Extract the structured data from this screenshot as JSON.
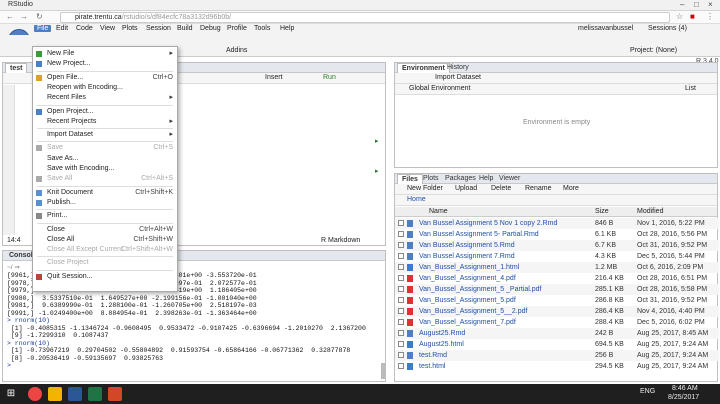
{
  "window": {
    "title": "RStudio"
  },
  "browser": {
    "url_scheme": "pirate.trentu.ca",
    "url_path": "/rstudio/s/df84ecfc78a3132d96b0b/"
  },
  "app_menu": [
    "File",
    "Edit",
    "Code",
    "View",
    "Plots",
    "Session",
    "Build",
    "Debug",
    "Profile",
    "Tools",
    "Help"
  ],
  "user": "melissavanbussel",
  "sessions": "Sessions (4)",
  "project": "Project: (None)",
  "r_version": "R 3.4.0",
  "toolbar": {
    "addins": "Addins"
  },
  "file_menu": [
    {
      "label": "New File",
      "arrow": "▸"
    },
    {
      "label": "New Project...",
      "shortcut": ""
    },
    {
      "sep": true
    },
    {
      "label": "Open File...",
      "shortcut": "Ctrl+O"
    },
    {
      "label": "Reopen with Encoding...",
      "shortcut": ""
    },
    {
      "label": "Recent Files",
      "arrow": "▸"
    },
    {
      "sep": true
    },
    {
      "label": "Open Project...",
      "shortcut": ""
    },
    {
      "label": "Recent Projects",
      "arrow": "▸"
    },
    {
      "sep": true
    },
    {
      "label": "Import Dataset",
      "arrow": "▸"
    },
    {
      "sep": true
    },
    {
      "label": "Save",
      "shortcut": "Ctrl+S",
      "disabled": true
    },
    {
      "label": "Save As...",
      "shortcut": ""
    },
    {
      "label": "Save with Encoding...",
      "shortcut": ""
    },
    {
      "label": "Save All",
      "shortcut": "Ctrl+Alt+S",
      "disabled": true
    },
    {
      "sep": true
    },
    {
      "label": "Knit Document",
      "shortcut": "Ctrl+Shift+K"
    },
    {
      "label": "Publish...",
      "shortcut": ""
    },
    {
      "sep": true
    },
    {
      "label": "Print...",
      "shortcut": ""
    },
    {
      "sep": true
    },
    {
      "label": "Close",
      "shortcut": "Ctrl+Alt+W"
    },
    {
      "label": "Close All",
      "shortcut": "Ctrl+Shift+W"
    },
    {
      "label": "Close All Except Current",
      "shortcut": "Ctrl+Shift+Alt+W",
      "disabled": true
    },
    {
      "sep": true
    },
    {
      "label": "Close Project",
      "shortcut": "",
      "disabled": true
    },
    {
      "sep": true
    },
    {
      "label": "Quit Session...",
      "shortcut": ""
    }
  ],
  "editor": {
    "tab": "test",
    "insert": "Insert",
    "run": "Run",
    "pos": "14:4",
    "mode": "R Markdown"
  },
  "env": {
    "tabs": [
      "Environment",
      "History"
    ],
    "import": "Import Dataset",
    "scope": "Global Environment",
    "list": "List",
    "empty": "Environment is empty"
  },
  "files": {
    "tabs": [
      "Files",
      "Plots",
      "Packages",
      "Help",
      "Viewer"
    ],
    "toolbar": [
      "New Folder",
      "Upload",
      "Delete",
      "Rename",
      "More"
    ],
    "home": "Home",
    "headers": [
      "Name",
      "Size",
      "Modified"
    ],
    "rows": [
      [
        "Van Bussel Assignment 5 Nov 1 copy 2.Rmd",
        "846 B",
        "Nov 1, 2016, 5:22 PM"
      ],
      [
        "Van Bussel Assignment 5- Partial.Rmd",
        "6.1 KB",
        "Oct 28, 2016, 5:56 PM"
      ],
      [
        "Van Bussel Assignment 5.Rmd",
        "6.7 KB",
        "Oct 31, 2016, 9:52 PM"
      ],
      [
        "Van Bussel Assignment 7.Rmd",
        "4.3 KB",
        "Dec 5, 2016, 5:44 PM"
      ],
      [
        "Van_Bussel_Assignment_1.html",
        "1.2 MB",
        "Oct 6, 2016, 2:09 PM"
      ],
      [
        "Van_Bussel_Assignment_4.pdf",
        "216.4 KB",
        "Oct 28, 2016, 6:51 PM"
      ],
      [
        "Van_Bussel_Assignment_5 _Partial.pdf",
        "285.1 KB",
        "Oct 28, 2016, 5:58 PM"
      ],
      [
        "Van_Bussel_Assignment_5.pdf",
        "286.8 KB",
        "Oct 31, 2016, 9:52 PM"
      ],
      [
        "Van_Bussel_Assignment_5__2.pdf",
        "286.4 KB",
        "Nov 4, 2016, 4:40 PM"
      ],
      [
        "Van_Bussel_Assignment_7.pdf",
        "288.4 KB",
        "Dec 5, 2016, 6:02 PM"
      ],
      [
        "August25.Rmd",
        "242 B",
        "Aug 25, 2017, 8:45 AM"
      ],
      [
        "August25.html",
        "694.5 KB",
        "Aug 25, 2017, 9:24 AM"
      ],
      [
        "test.Rmd",
        "256 B",
        "Aug 25, 2017, 9:24 AM"
      ],
      [
        "test.html",
        "294.5 KB",
        "Aug 25, 2017, 9:24 AM"
      ]
    ]
  },
  "console": {
    "title": "Console",
    "path": "~/ ⇒",
    "lines": [
      "[9961,] -7.7034975e-01  5.966006e-01  1.036801e+00 -3.553720e-01",
      "[9978,] -1.0022270e+00 -2.555517e-02  8.101997e-01  2.072577e-01",
      "[9979,] -6.4690530e-01  9.726848e-01  1.314619e+00  1.186405e+00",
      "[9980,]  3.5337510e-01  1.649527e+00 -2.199156e-01 -1.001040e+00",
      "[9981,]  9.6389990e-01  1.288100e-01 -1.260705e+00  2.518197e-03",
      "[9991,] -1.0249400e+00  8.884954e-01  2.398263e-01 -1.363464e+00",
      "> rnorm(10)",
      " [1] -0.4085315 -1.1346724 -0.9608495  0.9533472 -0.9107425 -0.6396694 -1.2010270  2.1367200",
      " [9] -1.7299310  0.1087437",
      "> rnorm(10)",
      " [1] -0.73967219  0.29704502 -0.55804892  0.91593754 -0.65864166 -0.06771362  0.32877878",
      " [8] -0.20536419 -0.59135697  0.93825763",
      ">"
    ]
  },
  "taskbar": {
    "lang": "ENG",
    "time": "8:46 AM",
    "date": "8/25/2017"
  },
  "colors": {
    "accent": "#4f7fc3",
    "link": "#1e4fa8"
  }
}
